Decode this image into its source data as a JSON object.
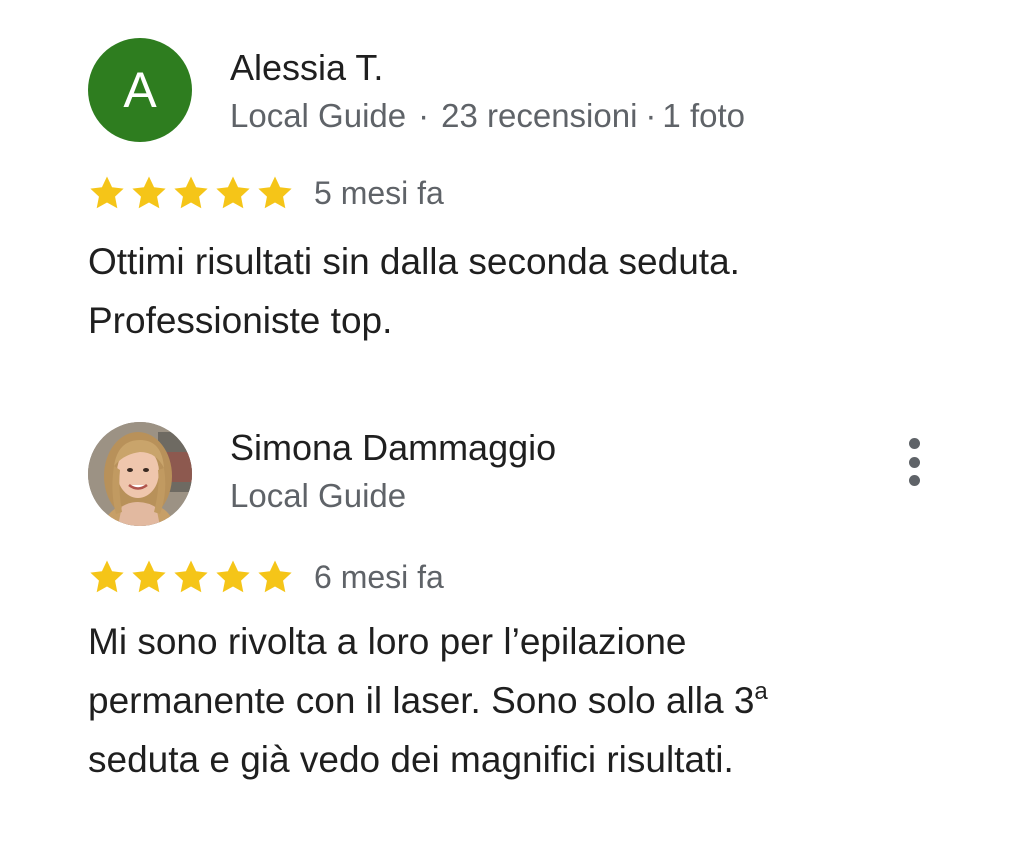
{
  "reviews": [
    {
      "avatar": {
        "type": "letter",
        "letter": "A",
        "color": "#2e7d1f"
      },
      "author": "Alessia T.",
      "badge": "Local Guide",
      "review_count": "23 recensioni",
      "photo_count": "1 foto",
      "rating": 5,
      "rating_max": 5,
      "date": "5 mesi fa",
      "text_lines": [
        "Ottimi risultati sin dalla seconda seduta.",
        "Professioniste top."
      ]
    },
    {
      "avatar": {
        "type": "photo"
      },
      "author": "Simona Dammaggio",
      "badge": "Local Guide",
      "rating": 5,
      "rating_max": 5,
      "date": "6 mesi fa",
      "text_lines": [
        "Mi sono rivolta a loro per l’epilazione",
        "permanente con il laser. Sono solo alla 3",
        "seduta e già vedo dei magnifici risultati."
      ],
      "text_superscript": "a",
      "more_icon": "more-vert-icon"
    }
  ],
  "colors": {
    "star": "#f5c518",
    "meta_text": "#5f6368",
    "body_text": "#1f1f1f",
    "avatar_green": "#2e7d1f"
  },
  "separator": "·"
}
